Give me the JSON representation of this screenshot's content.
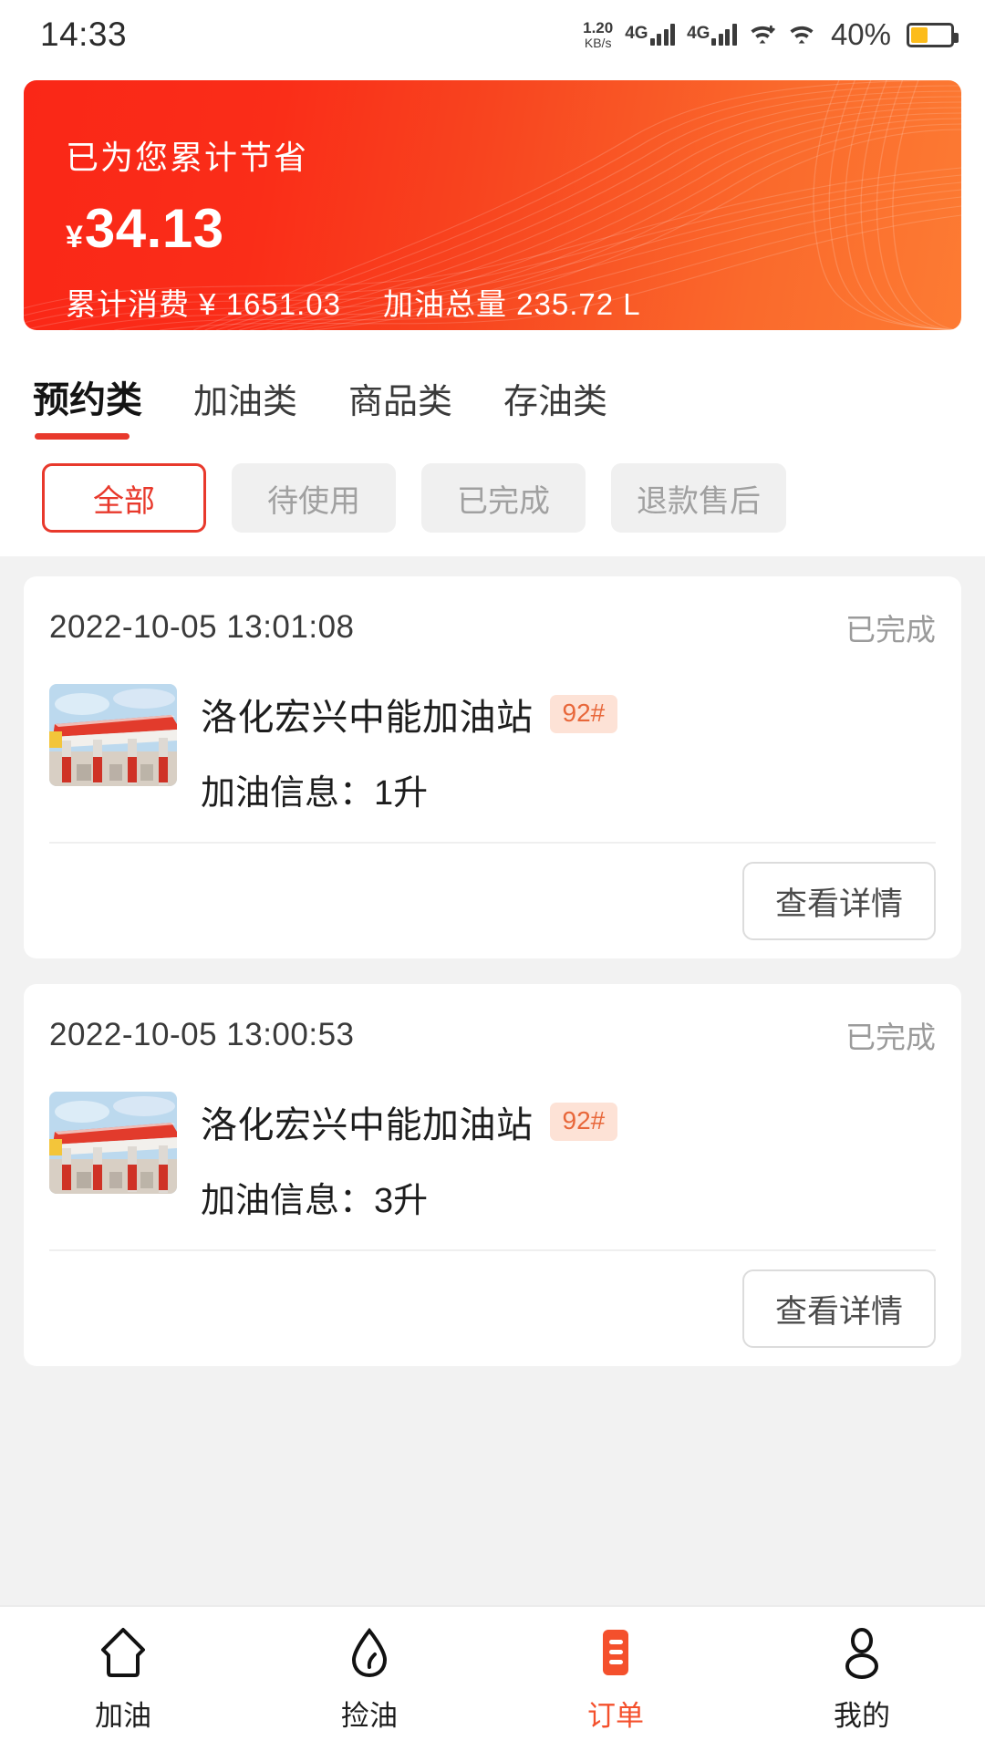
{
  "status_bar": {
    "time": "14:33",
    "net_speed_value": "1.20",
    "net_speed_unit": "KB/s",
    "sim1_label": "4G",
    "sim2_label": "4G",
    "battery_percent": "40%",
    "battery_level": 40
  },
  "banner": {
    "title": "已为您累计节省",
    "currency": "¥",
    "saved_amount": "34.13",
    "stat_spend_label": "累计消费",
    "stat_spend_currency": "¥",
    "stat_spend_value": "1651.03",
    "stat_volume_label": "加油总量",
    "stat_volume_value": "235.72 L",
    "color_start": "#FA2717",
    "color_end": "#FD7B33"
  },
  "tabs": [
    {
      "label": "预约类",
      "active": true
    },
    {
      "label": "加油类",
      "active": false
    },
    {
      "label": "商品类",
      "active": false
    },
    {
      "label": "存油类",
      "active": false
    }
  ],
  "filters": [
    {
      "label": "全部",
      "active": true
    },
    {
      "label": "待使用",
      "active": false
    },
    {
      "label": "已完成",
      "active": false
    },
    {
      "label": "退款售后",
      "active": false
    }
  ],
  "orders": [
    {
      "date": "2022-10-05 13:01:08",
      "status": "已完成",
      "station": "洛化宏兴中能加油站",
      "fuel_badge": "92#",
      "info_label": "加油信息：",
      "info_value": "1升",
      "detail_button": "查看详情",
      "thumbnail": "gas-station-photo"
    },
    {
      "date": "2022-10-05 13:00:53",
      "status": "已完成",
      "station": "洛化宏兴中能加油站",
      "fuel_badge": "92#",
      "info_label": "加油信息：",
      "info_value": "3升",
      "detail_button": "查看详情",
      "thumbnail": "gas-station-photo"
    }
  ],
  "bottom_nav": [
    {
      "label": "加油",
      "icon": "home-icon",
      "active": false
    },
    {
      "label": "捡油",
      "icon": "oil-drop-icon",
      "active": false
    },
    {
      "label": "订单",
      "icon": "order-list-icon",
      "active": true
    },
    {
      "label": "我的",
      "icon": "person-icon",
      "active": false
    }
  ],
  "accent_color": "#E8392C",
  "active_nav_color": "#F4502C"
}
